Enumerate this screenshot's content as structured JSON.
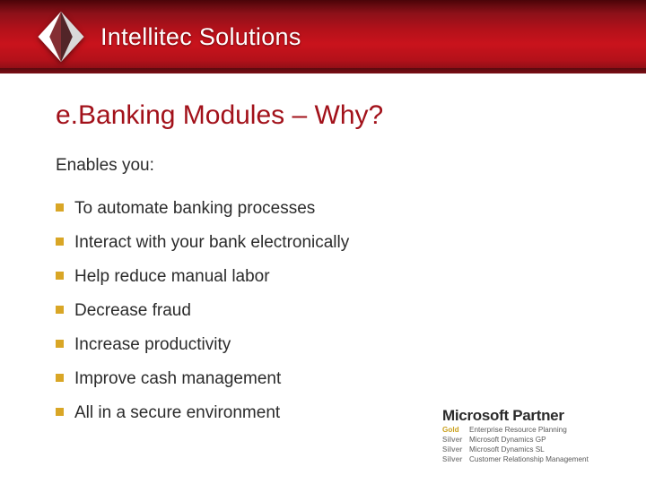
{
  "brand": "Intellitec Solutions",
  "title": "e.Banking Modules – Why?",
  "lead": "Enables you:",
  "bullets": [
    "To automate banking processes",
    "Interact with your bank electronically",
    "Help reduce manual labor",
    "Decrease fraud",
    "Increase productivity",
    "Improve cash management",
    "All in a secure environment"
  ],
  "partner": {
    "heading": "Microsoft Partner",
    "lines": [
      {
        "tier": "Gold",
        "tierClass": "gold",
        "competency": "Enterprise Resource Planning"
      },
      {
        "tier": "Silver",
        "tierClass": "silver",
        "competency": "Microsoft Dynamics GP"
      },
      {
        "tier": "Silver",
        "tierClass": "silver",
        "competency": "Microsoft Dynamics SL"
      },
      {
        "tier": "Silver",
        "tierClass": "silver",
        "competency": "Customer Relationship Management"
      }
    ]
  }
}
